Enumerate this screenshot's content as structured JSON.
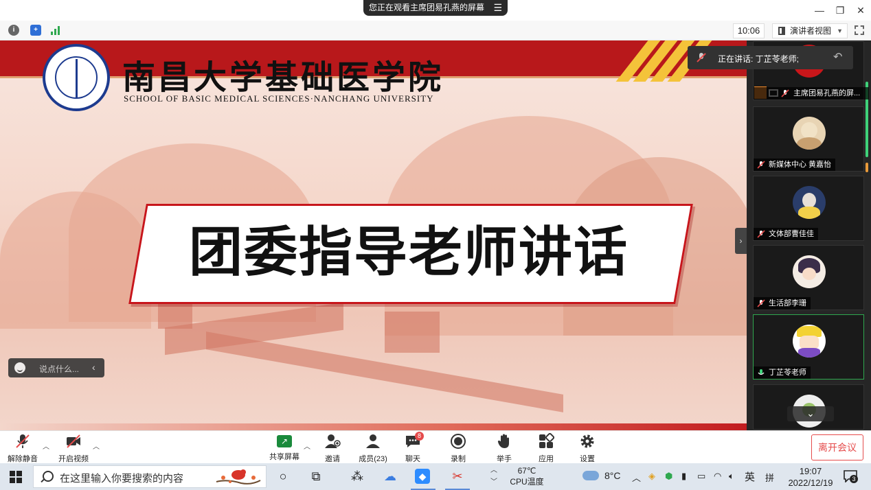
{
  "share_banner": {
    "text": "您正在观看主席团易孔燕的屏幕",
    "menu_icon": "hamburger-icon"
  },
  "window": {
    "minimize": "—",
    "restore": "❐",
    "close": "✕"
  },
  "meeting_bar": {
    "time": "10:06",
    "view_label": "演讲者视图"
  },
  "slide": {
    "school_cn": "南昌大学基础医学院",
    "school_en": "SCHOOL OF BASIC MEDICAL SCIENCES·NANCHANG UNIVERSITY",
    "title": "团委指导老师讲话"
  },
  "chat_input": {
    "placeholder": "说点什么..."
  },
  "speaking": {
    "label": "正在讲话: 丁芷苓老师;"
  },
  "participants": [
    {
      "name": "主席团易孔燕的屏..."
    },
    {
      "name": "新媒体中心 黄嘉怡"
    },
    {
      "name": "文体部曹佳佳"
    },
    {
      "name": "生活部李珊"
    },
    {
      "name": "丁芷苓老师"
    }
  ],
  "controls": {
    "unmute": "解除静音",
    "start_video": "开启视频",
    "share_screen": "共享屏幕",
    "invite": "邀请",
    "members": "成员(23)",
    "chat": "聊天",
    "chat_badge": "8",
    "record": "录制",
    "raise_hand": "举手",
    "apps": "应用",
    "settings": "设置",
    "leave": "离开会议"
  },
  "taskbar": {
    "search_placeholder": "在这里输入你要搜索的内容",
    "cpu_temp": "67℃",
    "cpu_label": "CPU温度",
    "weather_temp": "8°C",
    "ime": "英",
    "ime2": "拼",
    "time": "19:07",
    "date": "2022/12/19",
    "notifications": "3"
  },
  "colors": {
    "accent_red": "#b8181b",
    "active_green": "#2fa84f",
    "leave_red": "#e54b4b"
  }
}
